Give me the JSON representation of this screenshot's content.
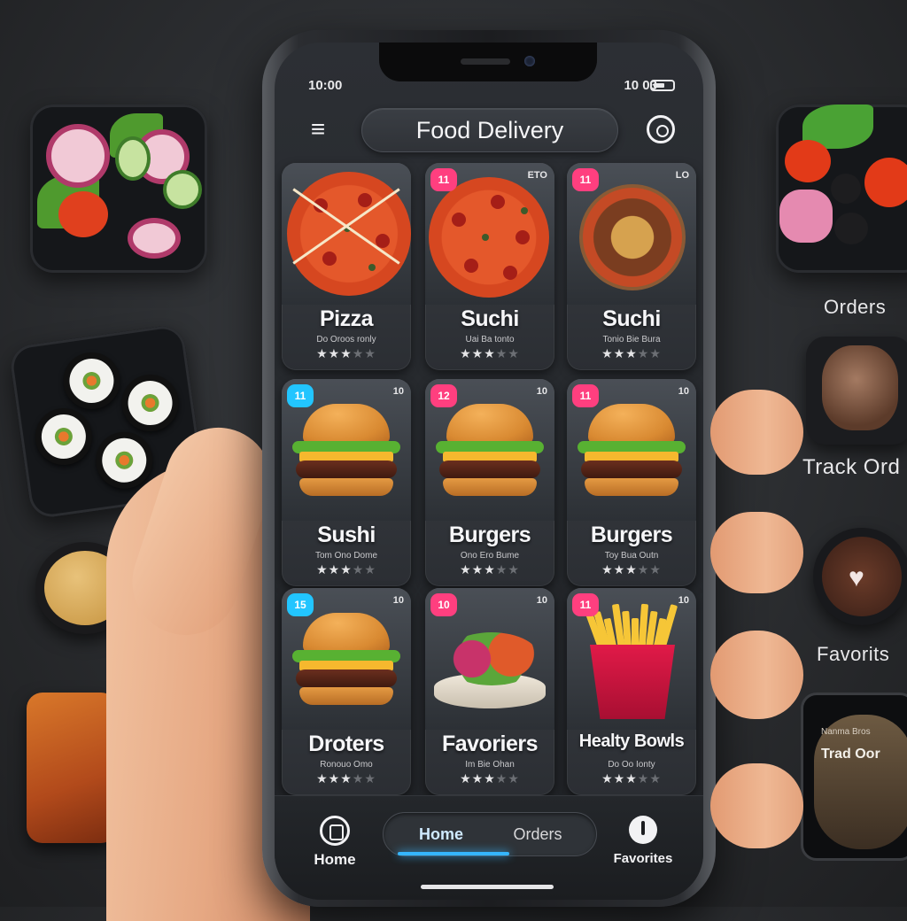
{
  "status_bar": {
    "time": "10:00",
    "right": "10 03"
  },
  "header": {
    "title": "Food Delivery"
  },
  "cards": [
    {
      "name": "Pizza",
      "subtitle": "Do Oroos ronly",
      "badge": "",
      "badge_color": "",
      "meta": "",
      "rating": 3,
      "image": "pizza-slices"
    },
    {
      "name": "Suchi",
      "subtitle": "Uai Ba tonto",
      "badge": "11",
      "badge_color": "#ff3f7f",
      "meta": "ETO",
      "rating": 3,
      "image": "pizza"
    },
    {
      "name": "Suchi",
      "subtitle": "Tonio Bie Bura",
      "badge": "11",
      "badge_color": "#ff3f7f",
      "meta": "LO",
      "rating": 3,
      "image": "bowl"
    },
    {
      "name": "Sushi",
      "subtitle": "Tom Ono Dome",
      "badge": "11",
      "badge_color": "#22c5ff",
      "meta": "10",
      "rating": 3,
      "image": "burger"
    },
    {
      "name": "Burgers",
      "subtitle": "Ono Ero Bume",
      "badge": "12",
      "badge_color": "#ff3f7f",
      "meta": "10",
      "rating": 3,
      "image": "burger"
    },
    {
      "name": "Burgers",
      "subtitle": "Toy Bua Outn",
      "badge": "11",
      "badge_color": "#ff3f7f",
      "meta": "10",
      "rating": 3,
      "image": "burger"
    },
    {
      "name": "Droters",
      "subtitle": "Ronouo Omo",
      "badge": "15",
      "badge_color": "#22c5ff",
      "meta": "10",
      "rating": 3,
      "image": "burger"
    },
    {
      "name": "Favoriers",
      "subtitle": "Im Bie Ohan",
      "badge": "10",
      "badge_color": "#ff3f7f",
      "meta": "10",
      "rating": 3,
      "image": "salad"
    },
    {
      "name": "Healty Bowls",
      "subtitle": "Do Oo Ionty",
      "badge": "11",
      "badge_color": "#ff3f7f",
      "meta": "10",
      "rating": 3,
      "image": "fries"
    }
  ],
  "bottom_nav": {
    "home_label": "Home",
    "segment_active": "Home",
    "segment_inactive": "Orders",
    "favorites_label": "Favorites"
  },
  "side_labels": {
    "orders": "Orders",
    "track_order": "Track Ord",
    "favorites": "Favorits",
    "mini_phone_title": "Trad Oor",
    "mini_phone_sub": "Nanma Bros"
  },
  "colors": {
    "accent": "#35b6ff",
    "badge_pink": "#ff3f7f",
    "badge_cyan": "#22c5ff"
  },
  "icons": {
    "menu": "hamburger-menu-icon",
    "search": "search-icon",
    "home": "home-icon",
    "favorites": "favorites-icon"
  }
}
